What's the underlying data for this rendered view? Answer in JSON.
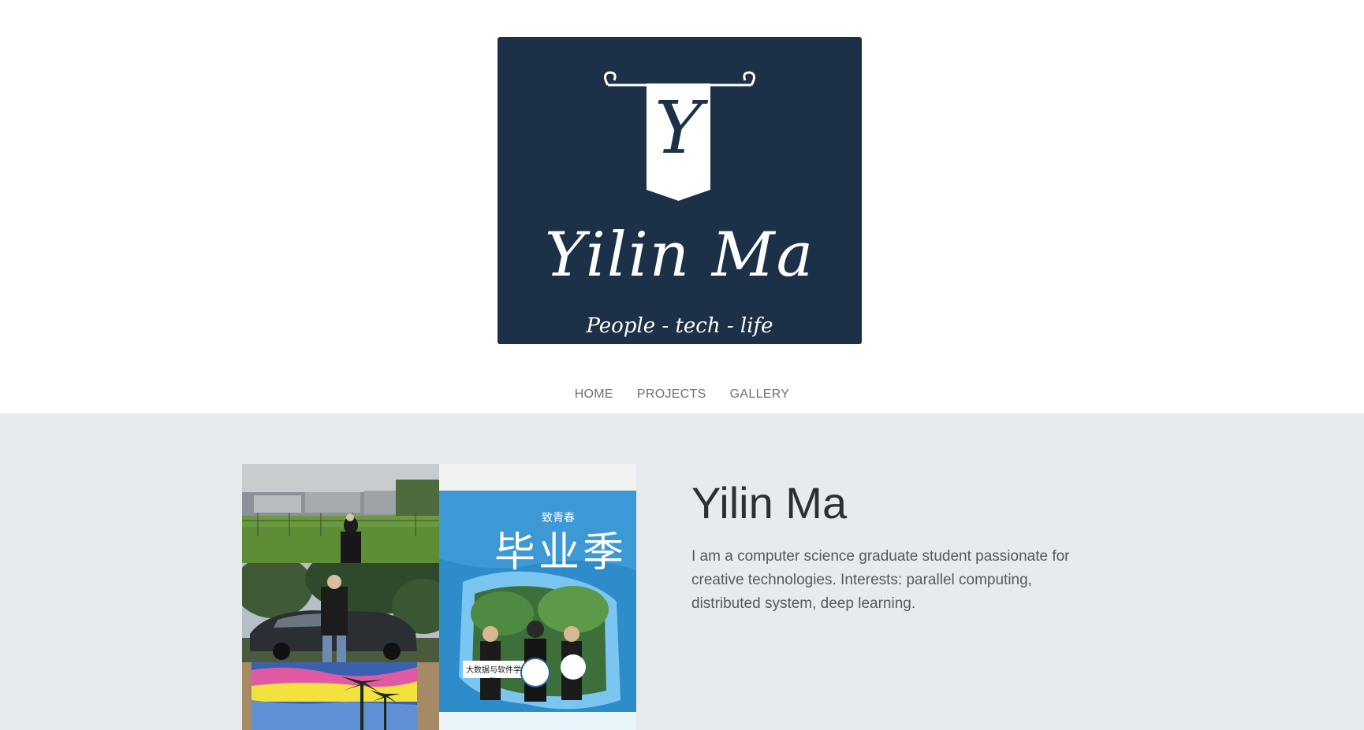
{
  "logo": {
    "initial": "Y",
    "name": "Yilin Ma",
    "tagline": "People - tech - life",
    "background": "#1c3047"
  },
  "nav": {
    "items": [
      {
        "label": "HOME"
      },
      {
        "label": "PROJECTS"
      },
      {
        "label": "GALLERY"
      }
    ]
  },
  "profile": {
    "name": "Yilin Ma",
    "bio": "I am a computer science graduate student passionate for creative technologies. Interests: parallel computing, distributed system, deep learning."
  },
  "gallery": {
    "banner_text": "毕业季",
    "banner_subtext": "致青春",
    "sign_left": "大数据与软件学院"
  },
  "colors": {
    "page_bg": "#ffffff",
    "content_bg": "#e8ebee",
    "nav_text": "#6b7178",
    "heading_text": "#2c2f33"
  }
}
